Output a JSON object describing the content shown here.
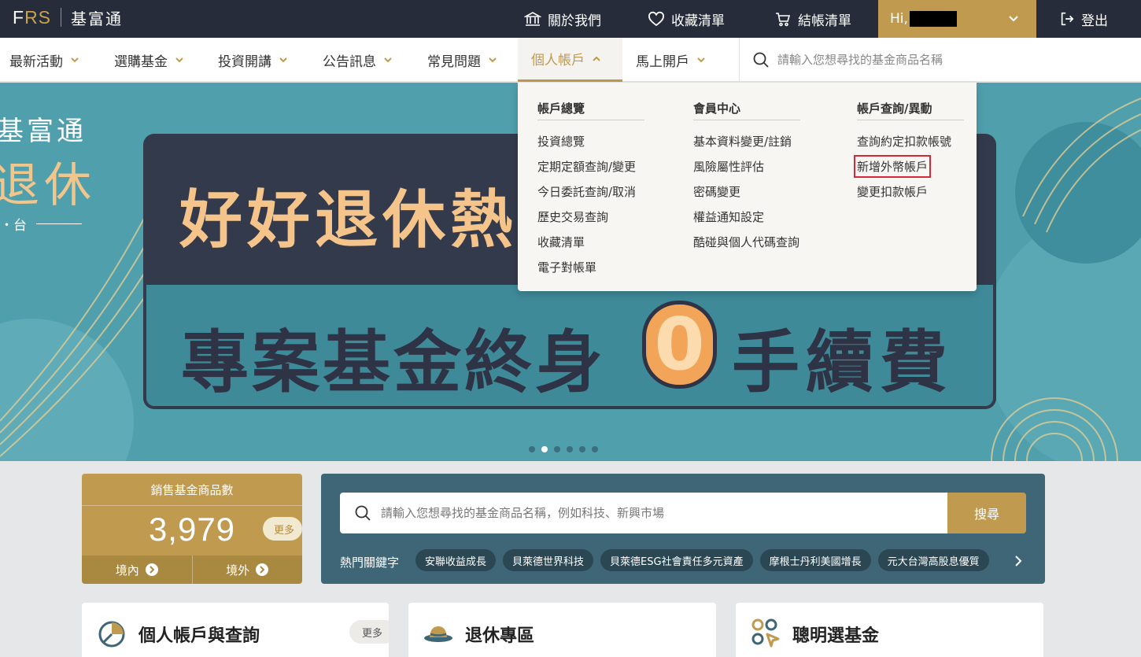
{
  "topbar": {
    "logo_mark_left": "F",
    "logo_mark_accent": "RS",
    "logo_name": "基富通",
    "about": "關於我們",
    "favorites": "收藏清單",
    "cart": "結帳清單",
    "greeting": "Hi,",
    "logout": "登出"
  },
  "nav": {
    "items": [
      {
        "label": "最新活動"
      },
      {
        "label": "選購基金"
      },
      {
        "label": "投資開講"
      },
      {
        "label": "公告訊息"
      },
      {
        "label": "常見問題"
      },
      {
        "label": "個人帳戶"
      },
      {
        "label": "馬上開戶"
      }
    ],
    "search_placeholder": "請輸入您想尋找的基金商品名稱"
  },
  "mega_menu": {
    "columns": [
      {
        "heading": "帳戶總覽",
        "links": [
          "投資總覽",
          "定期定額查詢/變更",
          "今日委託查詢/取消",
          "歷史交易查詢",
          "收藏清單",
          "電子對帳單"
        ]
      },
      {
        "heading": "會員中心",
        "links": [
          "基本資料變更/註銷",
          "風險屬性評估",
          "密碼變更",
          "權益通知設定",
          "酷碰與個人代碼查詢"
        ]
      },
      {
        "heading": "帳戶查詢/異動",
        "links": [
          "查詢約定扣款帳號",
          "新增外幣帳戶",
          "變更扣款帳戶"
        ]
      }
    ]
  },
  "banner": {
    "brand_line1": "基富通",
    "brand_line2": "退休",
    "brand_line3": "・台",
    "headline1": "好好退休熱",
    "headline2": "專案基金終身",
    "zero": "0",
    "headline3": "手續費"
  },
  "fund_count": {
    "label": "銷售基金商品數",
    "value": "3,979",
    "more": "更多",
    "domestic": "境內",
    "overseas": "境外"
  },
  "search_card": {
    "placeholder": "請輸入您想尋找的基金商品名稱，例如科技、新興市場",
    "button": "搜尋",
    "hot_label": "熱門關鍵字",
    "keywords": [
      "安聯收益成長",
      "貝萊德世界科技",
      "貝萊德ESG社會責任多元資產",
      "摩根士丹利美國增長",
      "元大台灣高股息優質"
    ]
  },
  "cards": {
    "account": {
      "title": "個人帳戶與查詢",
      "more": "更多"
    },
    "retire": {
      "title": "退休專區"
    },
    "smart": {
      "title": "聰明選基金"
    }
  },
  "colors": {
    "topbar": "#262c3a",
    "accent_gold": "#c09a4e",
    "banner_teal": "#4f9fad",
    "panel_dark": "#333a4b",
    "search_card": "#3e6676",
    "highlight_red": "#d5293a"
  }
}
